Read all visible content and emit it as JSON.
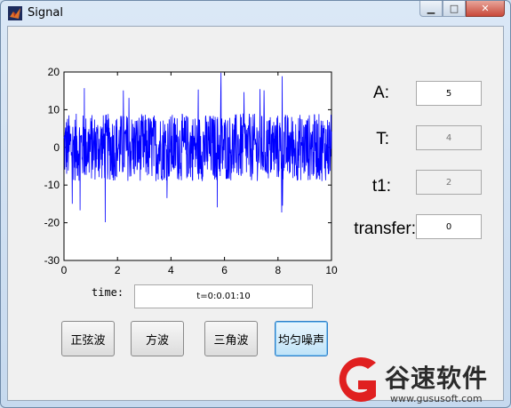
{
  "window": {
    "title": "Signal"
  },
  "plot": {
    "xlim": [
      0,
      10
    ],
    "ylim": [
      -30,
      20
    ],
    "x_ticks": [
      0,
      2,
      4,
      6,
      8,
      10
    ],
    "y_ticks": [
      20,
      10,
      0,
      -10,
      -20,
      -30
    ],
    "line_color": "#0000ff",
    "description": "uniform noise, amplitude about ±10 with spikes"
  },
  "params": {
    "A": {
      "label": "A:",
      "value": "5",
      "enabled": true
    },
    "T": {
      "label": "T:",
      "value": "4",
      "enabled": false
    },
    "t1": {
      "label": "t1:",
      "value": "2",
      "enabled": false
    },
    "transfer": {
      "label": "transfer:",
      "value": "0",
      "enabled": true
    }
  },
  "time": {
    "label": "time:",
    "value": "t=0:0.01:10"
  },
  "buttons": {
    "sine": "正弦波",
    "square": "方波",
    "triangle": "三角波",
    "noise": "均匀噪声"
  },
  "watermark": {
    "text": "谷速软件",
    "url": "www.gususoft.com"
  }
}
